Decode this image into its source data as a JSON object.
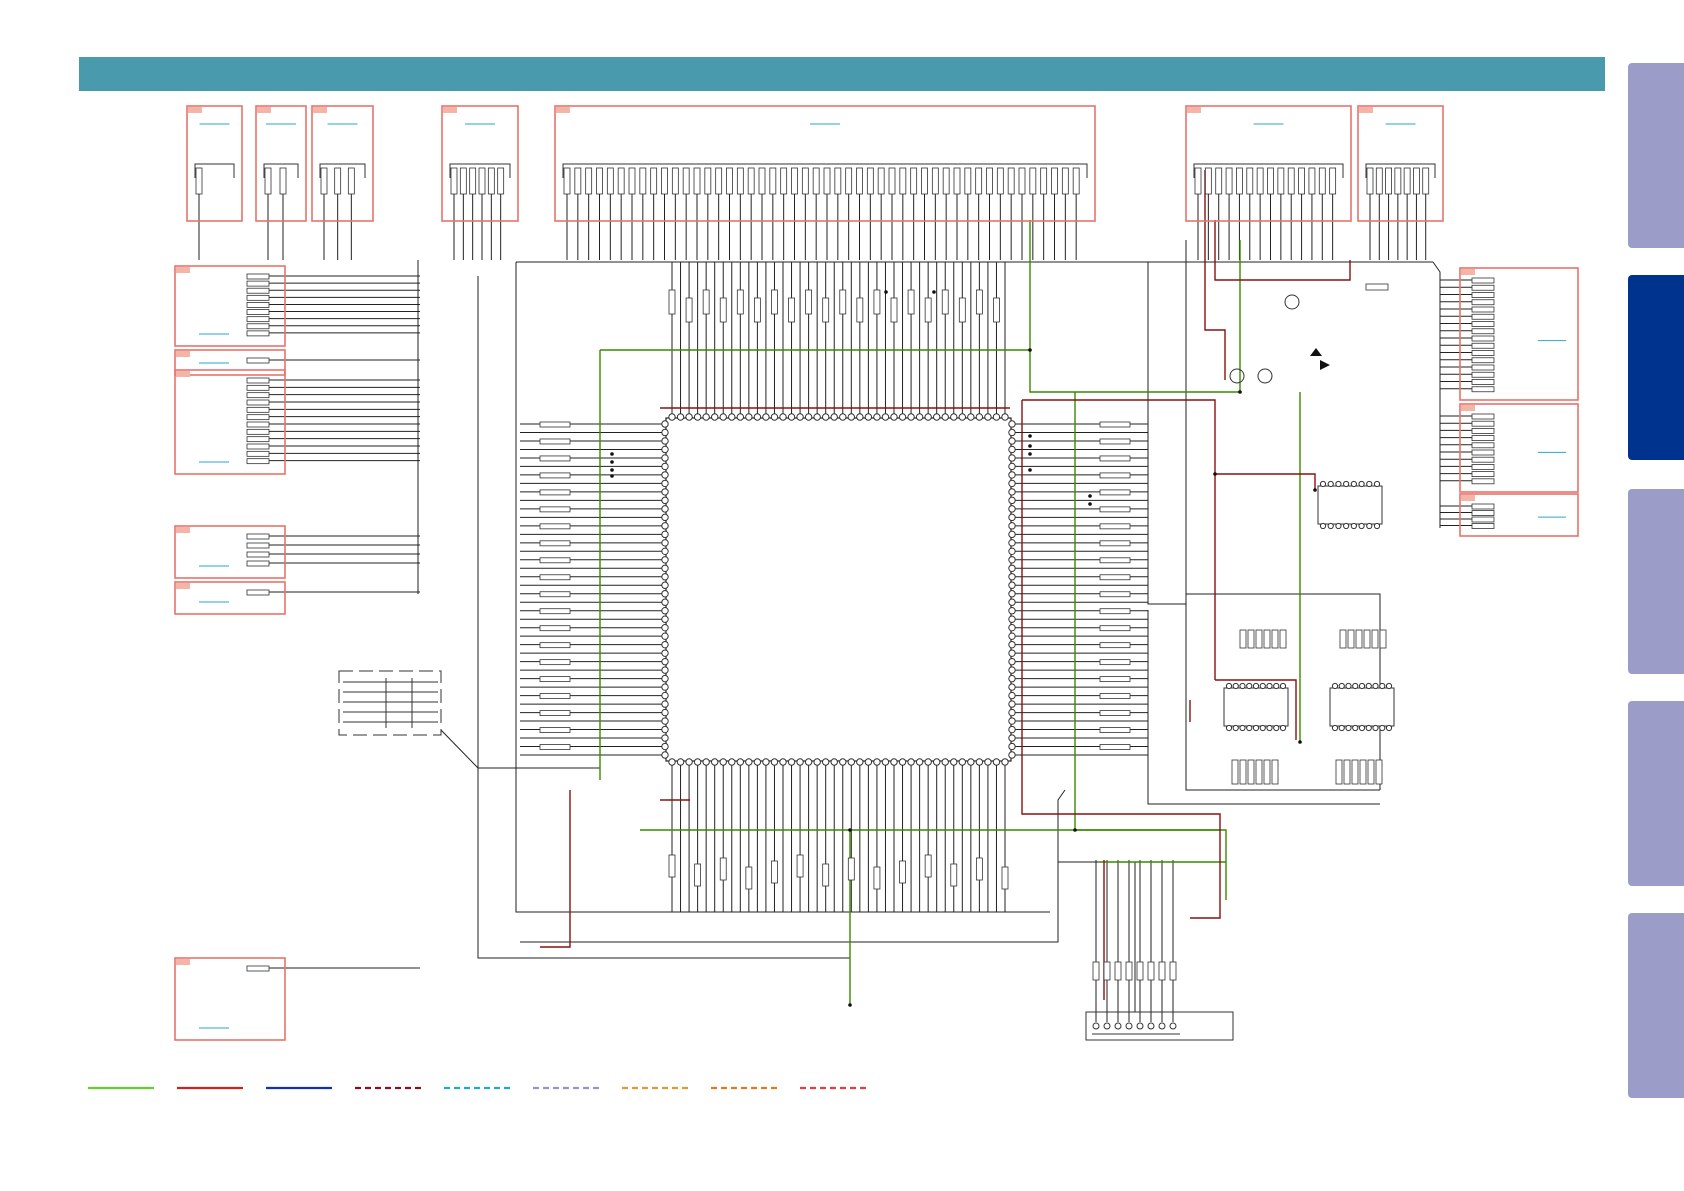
{
  "colors": {
    "header_bar": "#4a9aad",
    "tab_inactive": "#9b9cc8",
    "tab_active": "#00338d",
    "connector_box": "#e8736c",
    "connector_tag": "#f4b4a8",
    "wire_black": "#222222",
    "wire_green": "#3a8a00",
    "wire_red": "#8a1010",
    "blue_underline": "#2aa7c9"
  },
  "tabs": [
    {
      "active": false
    },
    {
      "active": true
    },
    {
      "active": false
    },
    {
      "active": false
    },
    {
      "active": false
    }
  ],
  "legend": {
    "items": [
      {
        "color": "#66cc33",
        "style": "solid"
      },
      {
        "color": "#cc2222",
        "style": "solid"
      },
      {
        "color": "#1133aa",
        "style": "solid"
      },
      {
        "color": "#8a1020",
        "style": "dashed"
      },
      {
        "color": "#22aacc",
        "style": "dashed"
      },
      {
        "color": "#9a90d0",
        "style": "dashed"
      },
      {
        "color": "#e09a30",
        "style": "dashed"
      },
      {
        "color": "#e07a20",
        "style": "dashed"
      },
      {
        "color": "#e04040",
        "style": "dashed"
      }
    ]
  }
}
